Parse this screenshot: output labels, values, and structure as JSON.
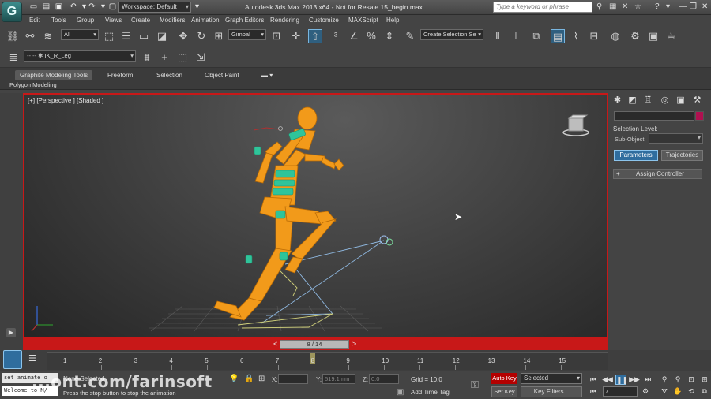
{
  "window": {
    "title": "Autodesk 3ds Max  2013 x64  - Not for Resale    15_begin.max",
    "logo": "G",
    "workspace": "Workspace: Default",
    "search_placeholder": "Type a keyword or phrase"
  },
  "menus": [
    "Edit",
    "Tools",
    "Group",
    "Views",
    "Create",
    "Modifiers",
    "Animation",
    "Graph Editors",
    "Rendering",
    "Customize",
    "MAXScript",
    "Help"
  ],
  "toolbar": {
    "selection_filter": "All",
    "ref_coord": "Gimbal",
    "named_selection": "Create Selection Se",
    "layer_name": "IK_R_Leg"
  },
  "ribbon": {
    "tabs": [
      "Graphite Modeling Tools",
      "Freeform",
      "Selection",
      "Object Paint"
    ],
    "active_tab": "Graphite Modeling Tools",
    "sub_label": "Polygon Modeling"
  },
  "viewport": {
    "label": "[+] [Perspective ] [Shaded ]",
    "time_slider": "8 / 14",
    "accent": "#c81818",
    "figure_color": "#f29a1a",
    "joint_color": "#2fc49a"
  },
  "command_panel": {
    "selection_level": "Selection Level:",
    "sub_object": "Sub-Object",
    "buttons": [
      "Parameters",
      "Trajectories"
    ],
    "rollout": "Assign Controller",
    "rollout_sign": "+"
  },
  "timeline": {
    "ticks": [
      "1",
      "2",
      "3",
      "4",
      "5",
      "6",
      "7",
      "8",
      "9",
      "10",
      "11",
      "12",
      "13",
      "14",
      "15"
    ],
    "current_frame": "8"
  },
  "status": {
    "maxscript_line1": "set animate o",
    "maxscript_line2": "Welcome to M/",
    "selection_info": "None Selected",
    "prompt": "Press the stop button to stop the animation",
    "watermark": "...ont.com/farinsoft",
    "x_label": "X:",
    "y_label": "Y:",
    "z_label": "Z:",
    "x_value": "",
    "y_value": "519.1mm",
    "z_value": "0.0",
    "grid": "Grid = 10.0",
    "add_time_tag": "Add Time Tag",
    "auto_key": "Auto Key",
    "set_key": "Set Key",
    "key_mode": "Selected",
    "key_filters": "Key Filters...",
    "frame_value": "7"
  }
}
